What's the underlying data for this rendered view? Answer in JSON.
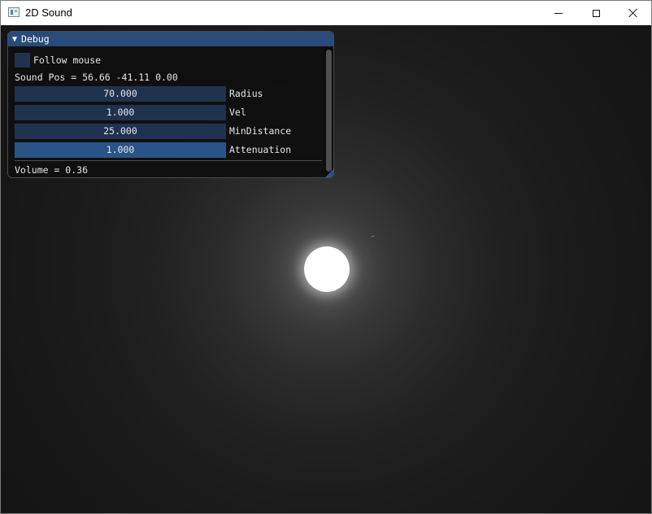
{
  "window": {
    "title": "2D Sound"
  },
  "debug": {
    "title": "Debug",
    "follow_mouse": {
      "label": "Follow mouse",
      "checked": false
    },
    "sound_pos": "Sound Pos = 56.66 -41.11 0.00",
    "sliders": [
      {
        "value": "70.000",
        "label": "Radius"
      },
      {
        "value": "1.000",
        "label": "Vel"
      },
      {
        "value": "25.000",
        "label": "MinDistance"
      },
      {
        "value": "1.000",
        "label": "Attenuation"
      }
    ],
    "volume": "Volume = 0.36"
  },
  "colors": {
    "title_bar_active": "#294a7a",
    "frame_bg": "#1f3250",
    "frame_bg_active": "#2a5488",
    "scene_bg": "#141414",
    "source": "#ffffff"
  },
  "icons": {
    "app": "app-icon",
    "minimize": "minimize-icon",
    "maximize": "maximize-icon",
    "close": "close-icon",
    "collapse": "collapse-triangle-icon"
  }
}
